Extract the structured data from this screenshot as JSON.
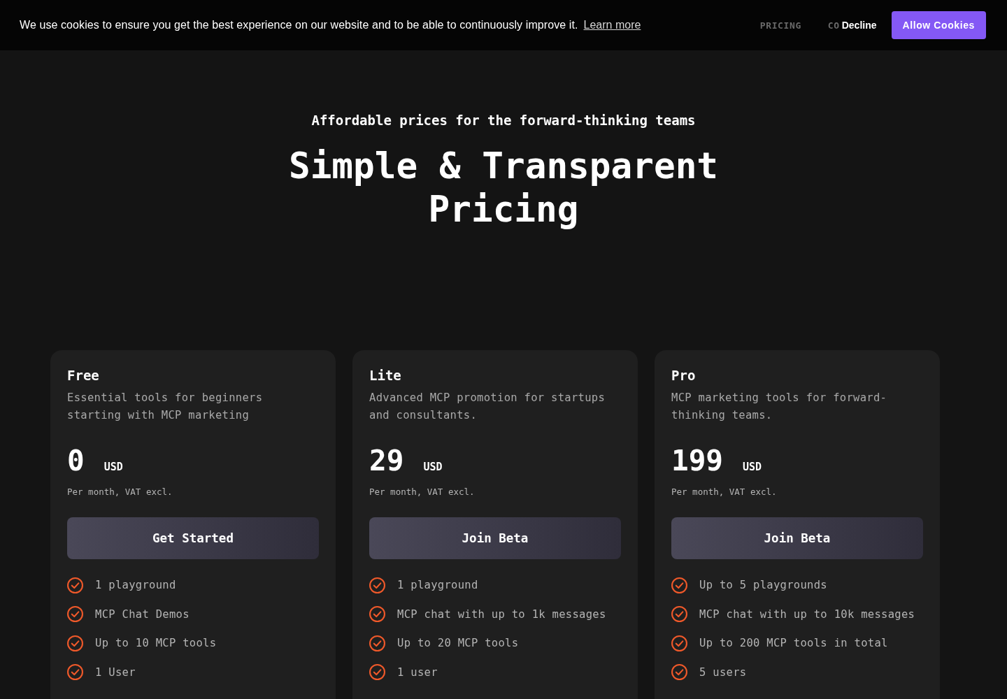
{
  "cookie_banner": {
    "message": "We use cookies to ensure you get the best experience on our website and to be able to continuously improve it.",
    "link": "Learn more",
    "buttons": [
      {
        "label": "Decline",
        "kind": "text"
      },
      {
        "label": "Allow Cookies",
        "kind": "primary"
      }
    ]
  },
  "nav": {
    "items": [
      "PRICING",
      "CO"
    ]
  },
  "hero": {
    "eyebrow": "Affordable prices for the forward-thinking teams",
    "title": "Simple & Transparent Pricing"
  },
  "plans": [
    {
      "name": "Free",
      "description": "Essential tools for beginners starting with MCP marketing",
      "price": "0",
      "currency": "USD",
      "period": "Per month, VAT excl.",
      "button": "Get Started",
      "features": [
        "1 playground",
        "MCP Chat Demos",
        "Up to 10 MCP tools",
        "1 User"
      ]
    },
    {
      "name": "Lite",
      "description": "Advanced MCP promotion for startups and consultants.",
      "price": "29",
      "currency": "USD",
      "period": "Per month, VAT excl.",
      "button": "Join Beta",
      "features": [
        "1 playground",
        "MCP chat with up to 1k messages",
        "Up to 20 MCP tools",
        "1 user"
      ]
    },
    {
      "name": "Pro",
      "description": "MCP marketing tools for forward-thinking teams.",
      "price": "199",
      "currency": "USD",
      "period": "Per month, VAT excl.",
      "button": "Join Beta",
      "features": [
        "Up to 5 playgrounds",
        "MCP chat with up to 10k messages",
        "Up to 200 MCP tools in total",
        "5 users"
      ]
    }
  ]
}
